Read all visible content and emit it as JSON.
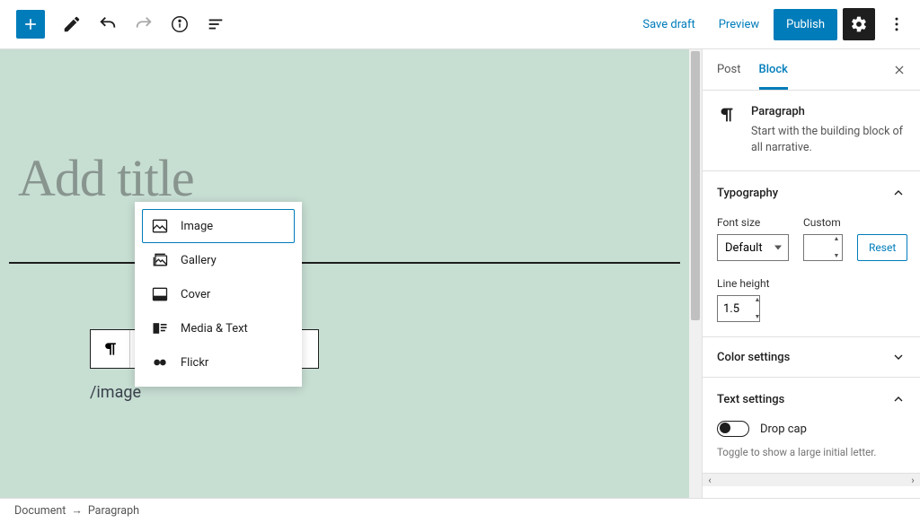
{
  "toolbar": {
    "save_draft": "Save draft",
    "preview": "Preview",
    "publish": "Publish"
  },
  "editor": {
    "title_placeholder": "Add title",
    "slash_command": "/image"
  },
  "inserter": {
    "items": [
      {
        "label": "Image",
        "selected": true
      },
      {
        "label": "Gallery",
        "selected": false
      },
      {
        "label": "Cover",
        "selected": false
      },
      {
        "label": "Media & Text",
        "selected": false
      },
      {
        "label": "Flickr",
        "selected": false
      }
    ]
  },
  "sidebar": {
    "tabs": {
      "post": "Post",
      "block": "Block",
      "active": "block"
    },
    "block": {
      "name": "Paragraph",
      "description": "Start with the building block of all narrative."
    },
    "panels": {
      "typography": {
        "title": "Typography",
        "font_size_label": "Font size",
        "font_size_value": "Default",
        "custom_label": "Custom",
        "custom_value": "",
        "reset_label": "Reset",
        "line_height_label": "Line height",
        "line_height_value": "1.5"
      },
      "color": {
        "title": "Color settings"
      },
      "text": {
        "title": "Text settings",
        "drop_cap_label": "Drop cap",
        "drop_cap_on": false,
        "hint": "Toggle to show a large initial letter."
      }
    }
  },
  "footer": {
    "crumb1": "Document",
    "crumb2": "Paragraph"
  }
}
